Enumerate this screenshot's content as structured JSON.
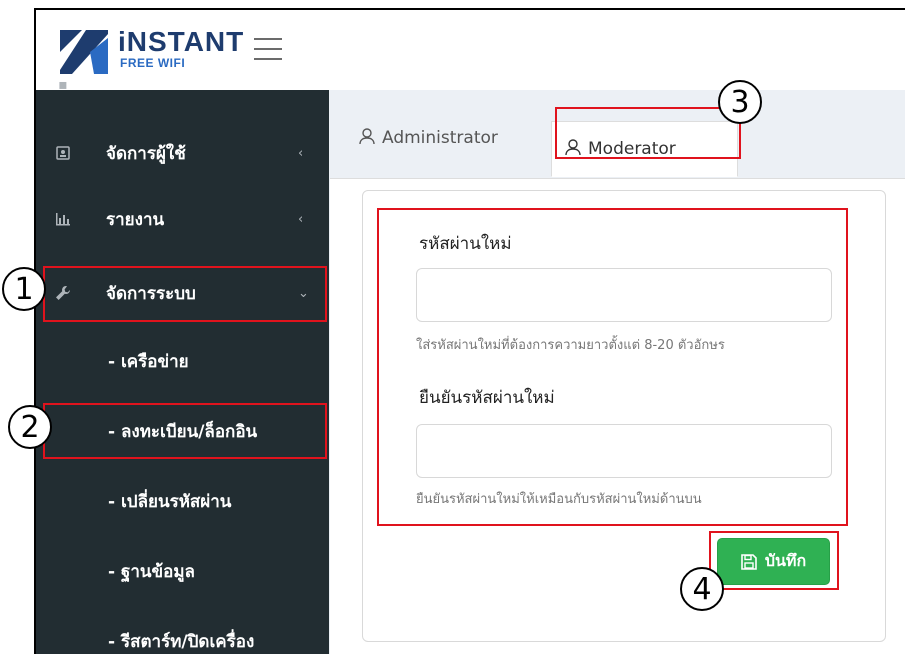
{
  "brand": {
    "name": "iNSTANT",
    "tagline": "FREE WIFI",
    "primary_color": "#1e3c6e",
    "accent_color": "#2a6ac2"
  },
  "sidebar": {
    "items": [
      {
        "label": "จัดการผู้ใช้",
        "icon": "user-card-icon",
        "arrow": "‹"
      },
      {
        "label": "รายงาน",
        "icon": "bar-chart-icon",
        "arrow": "‹"
      },
      {
        "label": "จัดการระบบ",
        "icon": "wrench-icon",
        "arrow": "⌄"
      }
    ],
    "subitems": [
      {
        "label": "- เครือข่าย"
      },
      {
        "label": "- ลงทะเบียน/ล็อกอิน"
      },
      {
        "label": "- เปลี่ยนรหัสผ่าน"
      },
      {
        "label": "- ฐานข้อมูล"
      },
      {
        "label": "- รีสตาร์ท/ปิดเครื่อง"
      }
    ],
    "bg_color": "#222d32"
  },
  "tabs": [
    {
      "label": "Administrator",
      "icon": "user-icon",
      "active": false
    },
    {
      "label": "Moderator",
      "icon": "user-icon",
      "active": true
    }
  ],
  "form": {
    "new_password_label": "รหัสผ่านใหม่",
    "new_password_value": "",
    "new_password_help": "ใส่รหัสผ่านใหม่ที่ต้องการความยาวตั้งแต่ 8-20 ตัวอักษร",
    "confirm_password_label": "ยืนยันรหัสผ่านใหม่",
    "confirm_password_value": "",
    "confirm_password_help": "ยืนยันรหัสผ่านใหม่ให้เหมือนกับรหัสผ่านใหม่ด้านบน",
    "save_label": "บันทึก",
    "save_color": "#2fb153"
  },
  "annotations": {
    "highlight_color": "#e0131d",
    "markers": [
      "1",
      "2",
      "3",
      "4"
    ]
  }
}
